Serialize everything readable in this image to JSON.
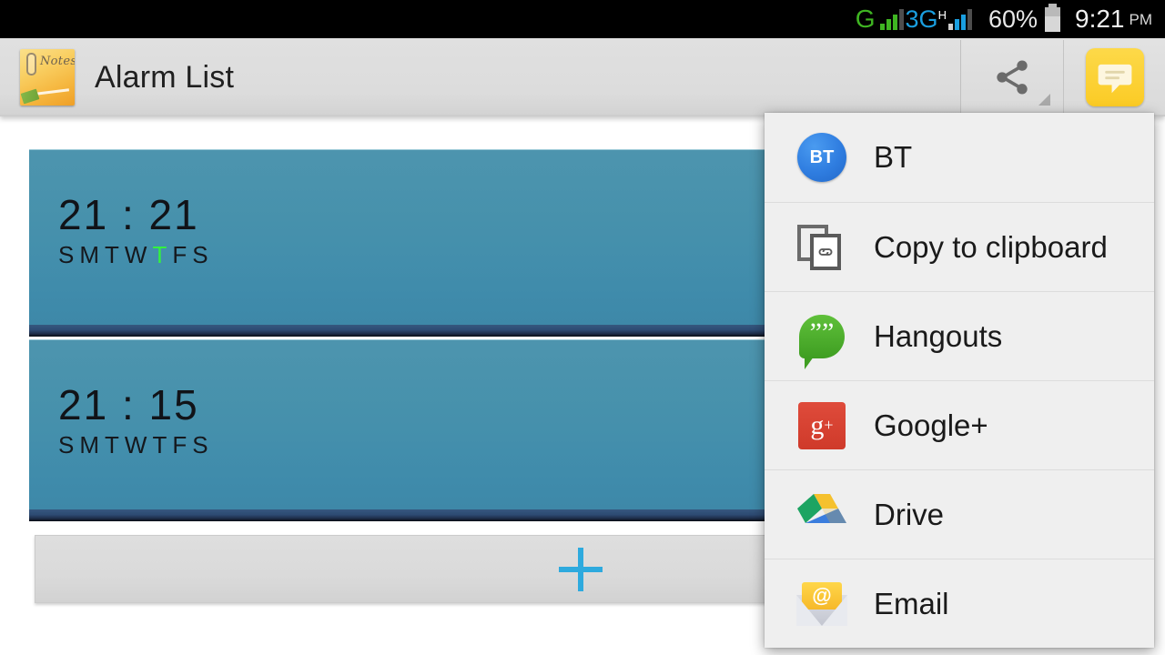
{
  "status_bar": {
    "network_g": "G",
    "network_3g": "3G",
    "network_h": "H",
    "battery_percent": "60%",
    "time": "9:21",
    "ampm": "PM"
  },
  "action_bar": {
    "app_icon_label": "Notes",
    "title": "Alarm List",
    "share_button_name": "share",
    "message_button_name": "message"
  },
  "alarms": [
    {
      "time": "21 : 21",
      "days": [
        "S",
        "M",
        "T",
        "W",
        "T",
        "F",
        "S"
      ],
      "active_day_indices": [
        4
      ]
    },
    {
      "time": "21 : 15",
      "days": [
        "S",
        "M",
        "T",
        "W",
        "T",
        "F",
        "S"
      ],
      "active_day_indices": []
    }
  ],
  "add_row": {
    "label": "+"
  },
  "share_popup": {
    "items": [
      {
        "label": "BT",
        "icon": "bt-icon",
        "badge": "BT"
      },
      {
        "label": "Copy to clipboard",
        "icon": "clipboard-icon",
        "badge": "∞"
      },
      {
        "label": "Hangouts",
        "icon": "hangouts-icon",
        "badge": "””"
      },
      {
        "label": "Google+",
        "icon": "google-plus-icon",
        "badge": "g"
      },
      {
        "label": "Drive",
        "icon": "drive-icon",
        "badge": ""
      },
      {
        "label": "Email",
        "icon": "email-icon",
        "badge": "@"
      }
    ]
  },
  "colors": {
    "status_bar_bg": "#000000",
    "action_bar_bg": "#dcdcdc",
    "alarm_card": "#4590ac",
    "alarm_strip": "#1e2e4a",
    "active_day": "#33f23e",
    "add_plus": "#2eaade",
    "popup_bg": "#efefef",
    "msg_button": "#fbcb25"
  }
}
